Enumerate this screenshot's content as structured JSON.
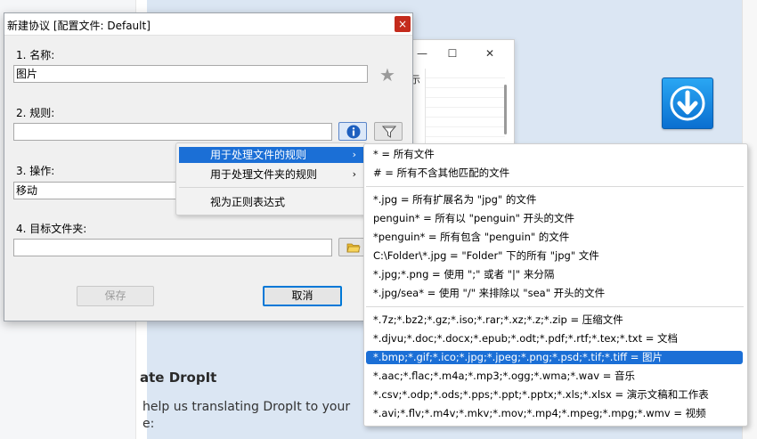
{
  "background": {
    "translate_heading": "ate DropIt",
    "translate_text_1": "help us translating DropIt to your",
    "translate_text_2": "e:",
    "bg_window_fragment": "示"
  },
  "dialog": {
    "title": "新建协议 [配置文件: Default]",
    "close_glyph": "×",
    "name_label": "1. 名称:",
    "name_value": "图片",
    "rules_label": "2. 规则:",
    "rules_value": "",
    "action_label": "3. 操作:",
    "action_value": "移动",
    "dest_label": "4. 目标文件夹:",
    "dest_value": "",
    "save_label": "保存",
    "cancel_label": "取消"
  },
  "context_menu": {
    "items": [
      {
        "label": "用于处理文件的规则",
        "submenu": true,
        "highlighted": true
      },
      {
        "label": "用于处理文件夹的规则",
        "submenu": true,
        "highlighted": false
      },
      {
        "label": "视为正则表达式",
        "submenu": false,
        "highlighted": false
      }
    ],
    "arrow_glyph": "›"
  },
  "submenu": {
    "groups": [
      [
        "* = 所有文件",
        "# = 所有不含其他匹配的文件"
      ],
      [
        "*.jpg = 所有扩展名为 \"jpg\" 的文件",
        "penguin* = 所有以 \"penguin\" 开头的文件",
        "*penguin* = 所有包含 \"penguin\" 的文件",
        "C:\\Folder\\*.jpg = \"Folder\" 下的所有 \"jpg\" 文件",
        "*.jpg;*.png = 使用 \";\" 或者 \"|\" 来分隔",
        "*.jpg/sea* = 使用 \"/\" 来排除以 \"sea\" 开头的文件"
      ],
      [
        "*.7z;*.bz2;*.gz;*.iso;*.rar;*.xz;*.z;*.zip = 压缩文件",
        "*.djvu;*.doc;*.docx;*.epub;*.odt;*.pdf;*.rtf;*.tex;*.txt = 文档",
        "*.bmp;*.gif;*.ico;*.jpg;*.jpeg;*.png;*.psd;*.tif;*.tiff = 图片",
        "*.aac;*.flac;*.m4a;*.mp3;*.ogg;*.wma;*.wav = 音乐",
        "*.csv;*.odp;*.ods;*.pps;*.ppt;*.pptx;*.xls;*.xlsx = 演示文稿和工作表",
        "*.avi;*.flv;*.m4v;*.mkv;*.mov;*.mp4;*.mpeg;*.mpg;*.wmv = 视频"
      ]
    ],
    "highlighted_item": "*.bmp;*.gif;*.ico;*.jpg;*.jpeg;*.png;*.psd;*.tif;*.tiff = 图片"
  },
  "colors": {
    "accent": "#1b6fd6",
    "close": "#c42b1c",
    "page_bg": "#dbe6f3"
  }
}
